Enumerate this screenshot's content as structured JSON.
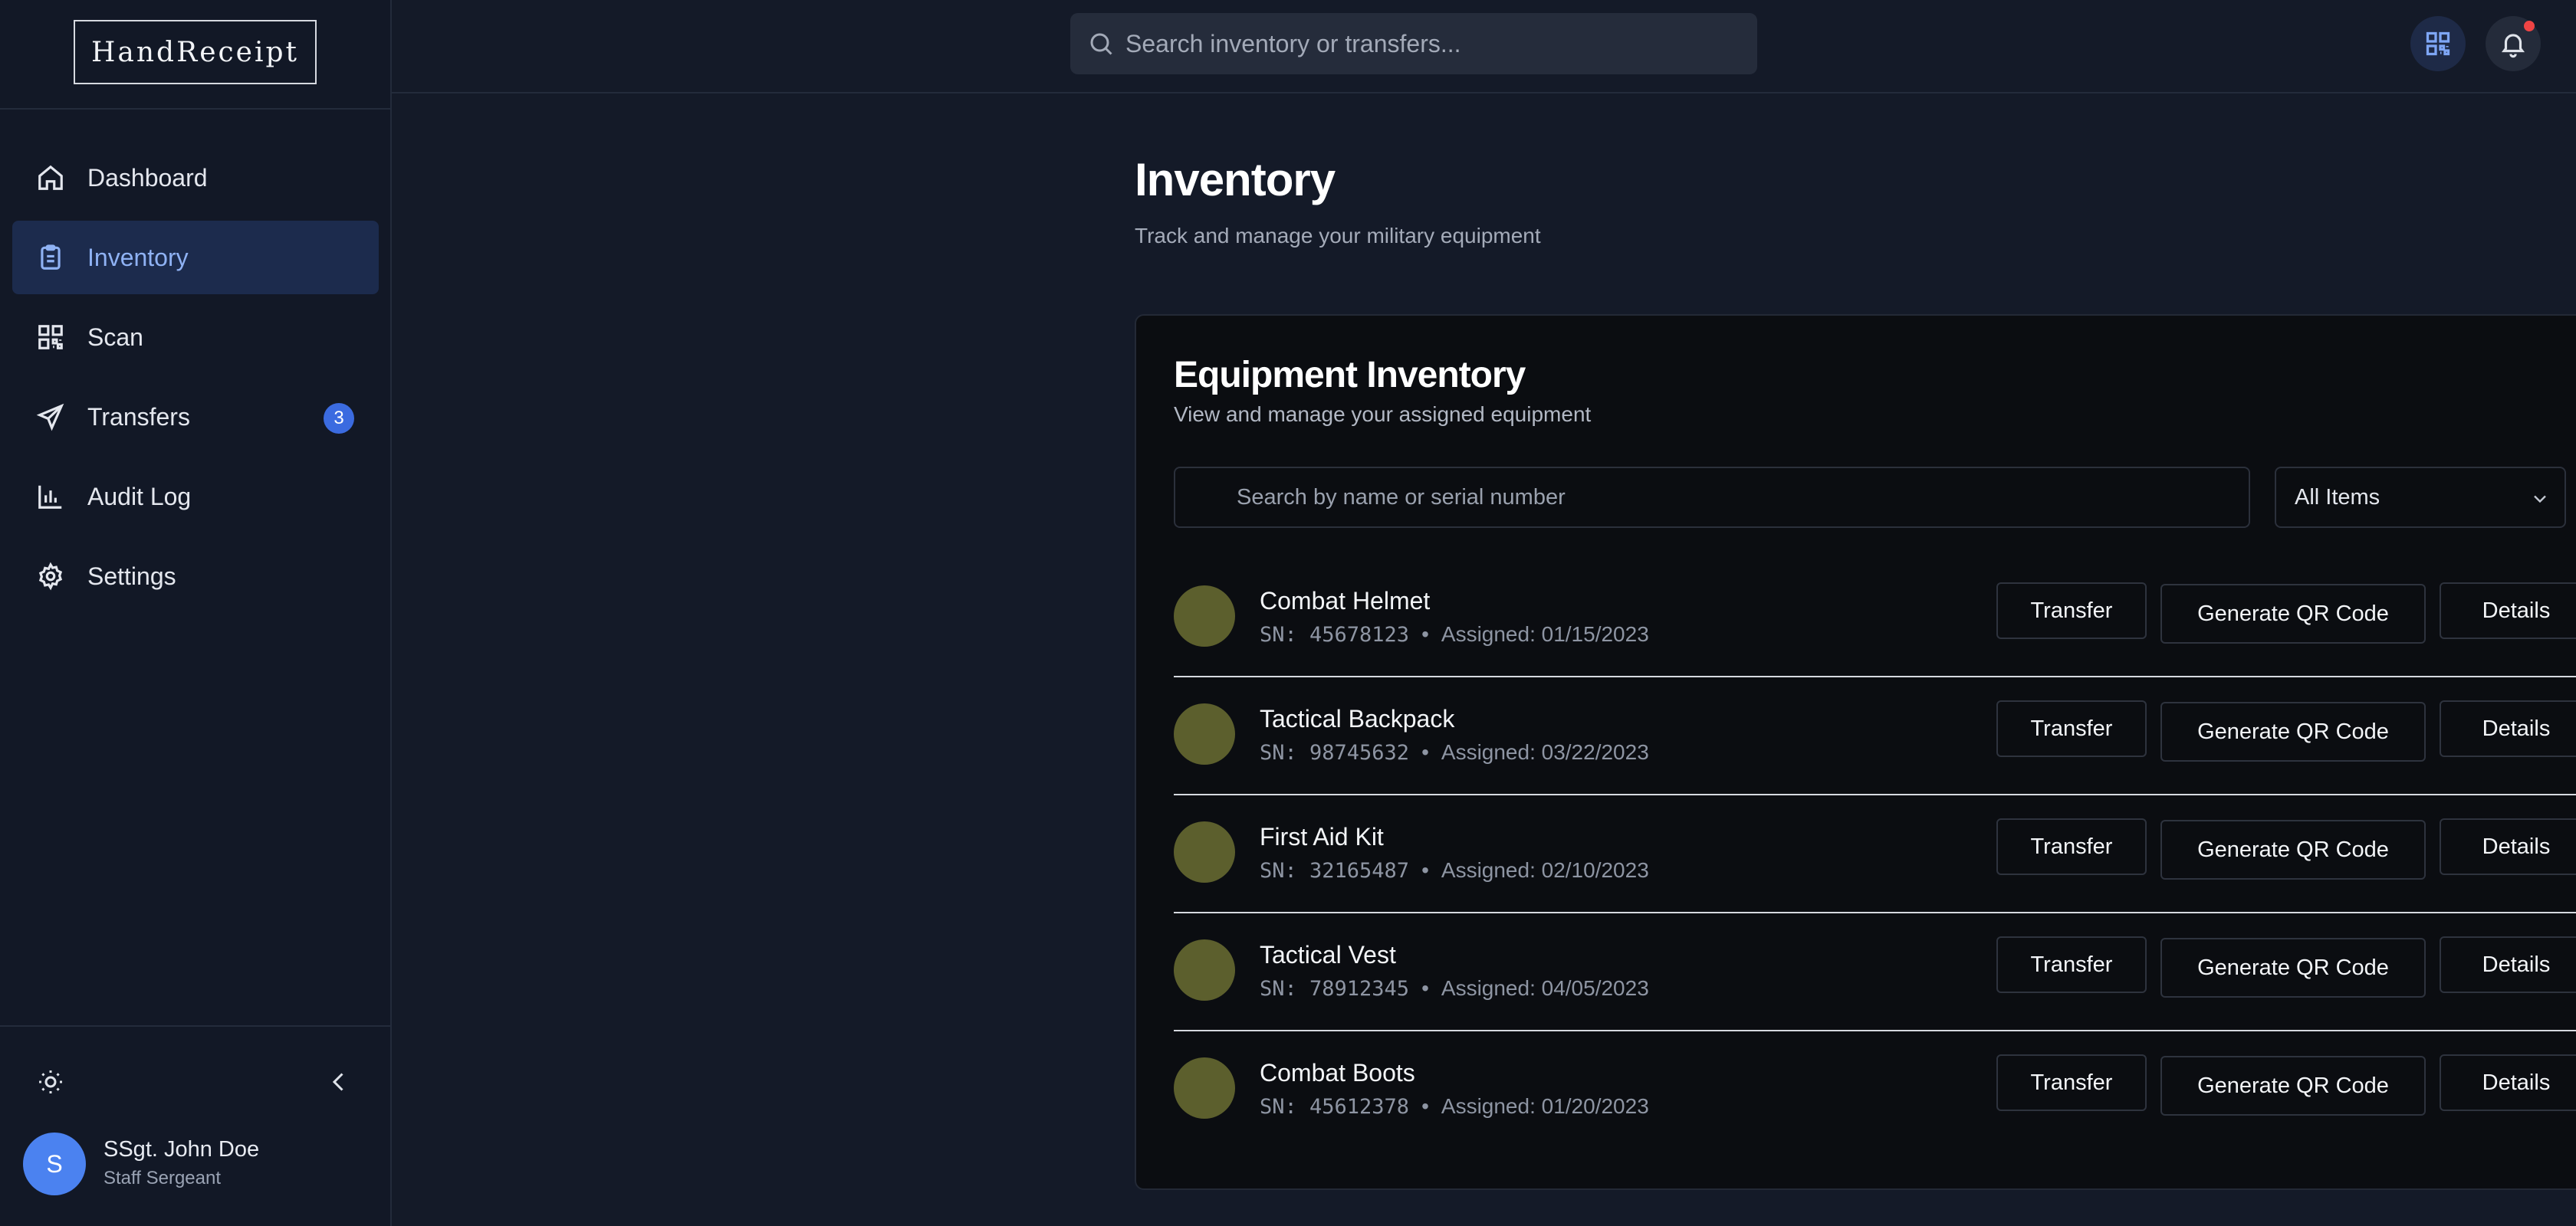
{
  "app": {
    "logo_text": "HandReceipt"
  },
  "sidebar": {
    "items": [
      {
        "label": "Dashboard",
        "icon": "home-icon"
      },
      {
        "label": "Inventory",
        "icon": "clipboard-icon",
        "active": true
      },
      {
        "label": "Scan",
        "icon": "qr-code-icon"
      },
      {
        "label": "Transfers",
        "icon": "send-icon",
        "badge": "3"
      },
      {
        "label": "Audit Log",
        "icon": "bar-chart-icon"
      },
      {
        "label": "Settings",
        "icon": "gear-icon"
      }
    ],
    "user": {
      "initial": "S",
      "name": "SSgt. John Doe",
      "rank": "Staff Sergeant"
    }
  },
  "topbar": {
    "search_placeholder": "Search inventory or transfers..."
  },
  "page": {
    "title": "Inventory",
    "subtitle": "Track and manage your military equipment"
  },
  "card": {
    "title": "Equipment Inventory",
    "subtitle": "View and manage your assigned equipment",
    "search_placeholder": "Search by name or serial number",
    "filter_value": "All Items",
    "items": [
      {
        "name": "Combat Helmet",
        "sn": "SN: 45678123",
        "assigned": "Assigned: 01/15/2023"
      },
      {
        "name": "Tactical Backpack",
        "sn": "SN: 98745632",
        "assigned": "Assigned: 03/22/2023"
      },
      {
        "name": "First Aid Kit",
        "sn": "SN: 32165487",
        "assigned": "Assigned: 02/10/2023"
      },
      {
        "name": "Tactical Vest",
        "sn": "SN: 78912345",
        "assigned": "Assigned: 04/05/2023"
      },
      {
        "name": "Combat Boots",
        "sn": "SN: 45612378",
        "assigned": "Assigned: 01/20/2023"
      }
    ],
    "actions": {
      "transfer": "Transfer",
      "qr": "Generate QR Code",
      "details": "Details"
    },
    "meta_separator": "•"
  },
  "colors": {
    "accent": "#3b6be0",
    "active_bg": "#1c2b4d",
    "thumb": "#5c5f2d",
    "notification": "#ef4444"
  }
}
